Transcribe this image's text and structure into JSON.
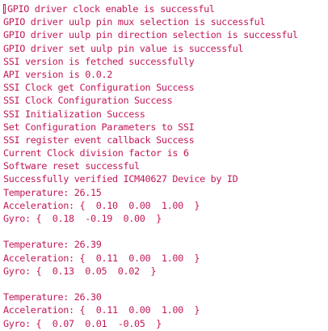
{
  "terminal": {
    "text_color": "#c2185b",
    "background_color": "#ffffff",
    "lines": [
      "GPIO driver clock enable is successful",
      "GPIO driver uulp pin mux selection is successful",
      "GPIO driver uulp pin direction selection is successful",
      "GPIO driver set uulp pin value is successful",
      "SSI version is fetched successfully",
      "API version is 0.0.2",
      "SSI Clock get Configuration Success",
      "SSI Clock Configuration Success",
      "SSI Initialization Success",
      "Set Configuration Parameters to SSI",
      "SSI register event callback Success",
      "Current Clock division factor is 6",
      "Software reset successful",
      "Successfully verified ICM40627 Device by ID",
      "Temperature: 26.15",
      "Acceleration: {  0.10  0.00  1.00  }",
      "Gyro: {  0.18  -0.19  0.00  }",
      "",
      "Temperature: 26.39",
      "Acceleration: {  0.11  0.00  1.00  }",
      "Gyro: {  0.13  0.05  0.02  }",
      "",
      "Temperature: 26.30",
      "Acceleration: {  0.11  0.00  1.00  }",
      "Gyro: {  0.07  0.01  -0.05  }"
    ]
  }
}
